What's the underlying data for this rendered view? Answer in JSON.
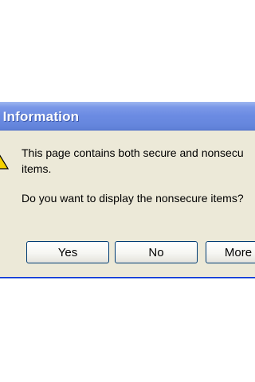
{
  "dialog": {
    "title": "y Information",
    "icon": "warning-icon",
    "message_line1": "This page contains both secure and nonsecu",
    "message_line2": "items.",
    "question": "Do you want to display the nonsecure items?",
    "buttons": {
      "yes": "Yes",
      "no": "No",
      "more": "More"
    }
  },
  "colors": {
    "title_bar": "#6b8be2",
    "dialog_bg": "#ece9d8",
    "border": "#0831d9",
    "button_border": "#003c74",
    "warning": "#f4d100"
  }
}
